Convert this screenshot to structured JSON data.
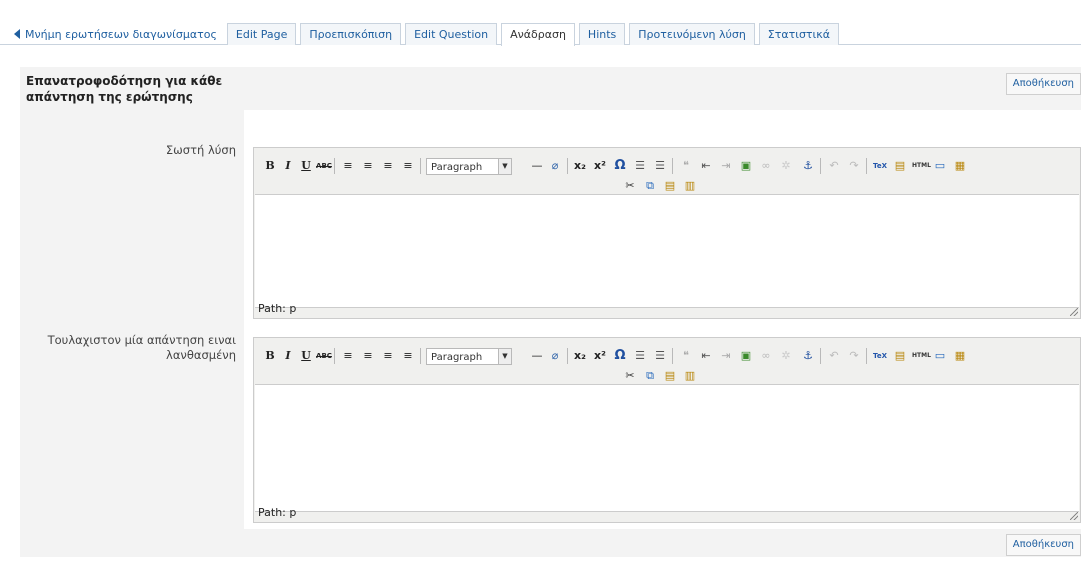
{
  "tabs": [
    {
      "label": "Μνήμη ερωτήσεων διαγωνίσματος",
      "active": false
    },
    {
      "label": "Edit Page",
      "active": false
    },
    {
      "label": "Προεπισκόπιση",
      "active": false
    },
    {
      "label": "Edit Question",
      "active": false
    },
    {
      "label": "Ανάδραση",
      "active": true
    },
    {
      "label": "Hints",
      "active": false
    },
    {
      "label": "Προτεινόμενη λύση",
      "active": false
    },
    {
      "label": "Στατιστικά",
      "active": false
    }
  ],
  "panel": {
    "title": "Επανατροφοδότηση για κάθε απάντηση της ερώτησης",
    "save_label": "Αποθήκευση"
  },
  "fields": [
    {
      "label": "Σωστή λύση",
      "path": "Path: p",
      "format": "Paragraph"
    },
    {
      "label": "Τουλαχιστον μία απάντηση ειναι λανθασμένη",
      "path": "Path: p",
      "format": "Paragraph"
    }
  ],
  "toolbar": {
    "bold": "B",
    "italic": "I",
    "underline": "U",
    "strike": "ABC",
    "tex": "TeX",
    "html": "HTML"
  },
  "colors": {
    "link": "#1f5fa0",
    "panel_bg": "#f3f3f3",
    "toolbar_bg": "#f0f0ee"
  }
}
